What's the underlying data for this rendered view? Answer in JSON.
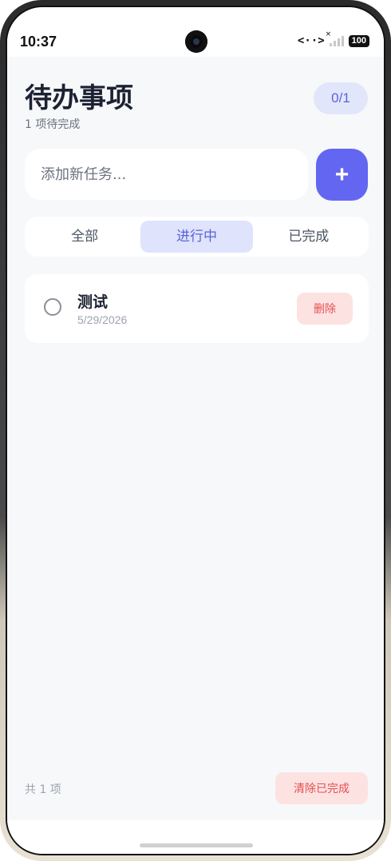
{
  "status_bar": {
    "time": "10:37",
    "battery": "100",
    "link_icon": "<··>",
    "signal_x": "×"
  },
  "header": {
    "title": "待办事项",
    "subtitle": "1 项待完成",
    "counter": "0/1"
  },
  "add": {
    "placeholder": "添加新任务...",
    "button_label": "+"
  },
  "tabs": [
    {
      "label": "全部",
      "active": false
    },
    {
      "label": "进行中",
      "active": true
    },
    {
      "label": "已完成",
      "active": false
    }
  ],
  "tasks": [
    {
      "title": "测试",
      "date": "5/29/2026",
      "delete_label": "删除",
      "completed": false
    }
  ],
  "footer": {
    "count": "共 1 项",
    "clear_label": "清除已完成"
  },
  "colors": {
    "accent": "#6366f1",
    "accent_light": "#e0e3fc",
    "danger": "#e45050",
    "danger_light": "#fde2e2",
    "background": "#f7f8fa"
  }
}
